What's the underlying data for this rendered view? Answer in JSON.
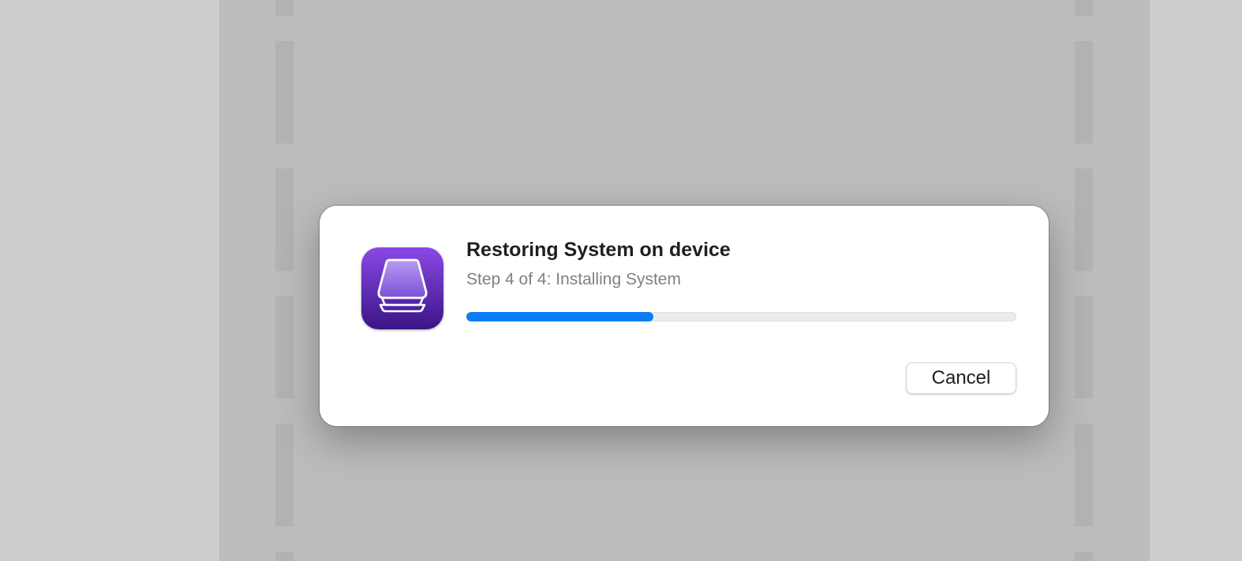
{
  "dialog": {
    "title": "Restoring System on device",
    "subtitle": "Step 4 of 4: Installing System",
    "progress_fraction": 0.34,
    "cancel_label": "Cancel"
  },
  "icons": {
    "app_icon": "apple-configurator-icon"
  },
  "colors": {
    "progress_accent": "#0a7cf6",
    "icon_purple_top": "#8a48e6",
    "icon_purple_bottom": "#3a1585"
  }
}
